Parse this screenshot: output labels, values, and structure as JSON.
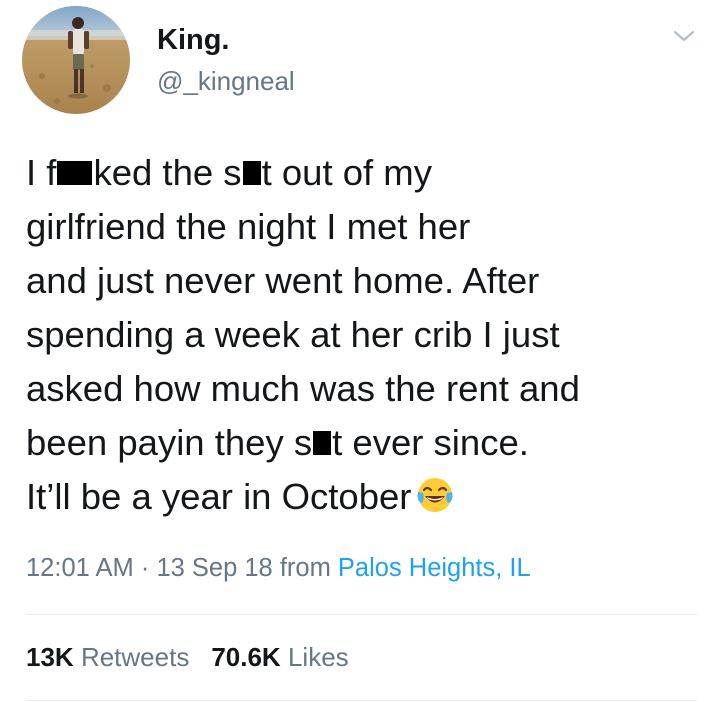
{
  "tweet": {
    "display_name": "King.",
    "handle": "@_kingneal",
    "avatar_icon": "profile-photo-beach",
    "menu_icon": "chevron-down-icon",
    "text_lines": [
      [
        "I f",
        "ked the s",
        "t out of my"
      ],
      "girlfriend the night I met her",
      "and just never went home. After",
      "spending a week at her crib I just",
      "asked how much was the rent and",
      [
        "been payin they s",
        "t ever since."
      ],
      "It’ll be a year in October"
    ],
    "emoji": "face-with-tears-of-joy",
    "time": "12:01 AM",
    "dot": "·",
    "date": "13 Sep 18",
    "from_label": "from",
    "location": "Palos Heights, IL",
    "retweets_count": "13K",
    "retweets_label": "Retweets",
    "likes_count": "70.6K",
    "likes_label": "Likes"
  },
  "colors": {
    "text": "#14171a",
    "secondary": "#657786",
    "link": "#1da1f2",
    "divider": "#e6ecf0"
  }
}
